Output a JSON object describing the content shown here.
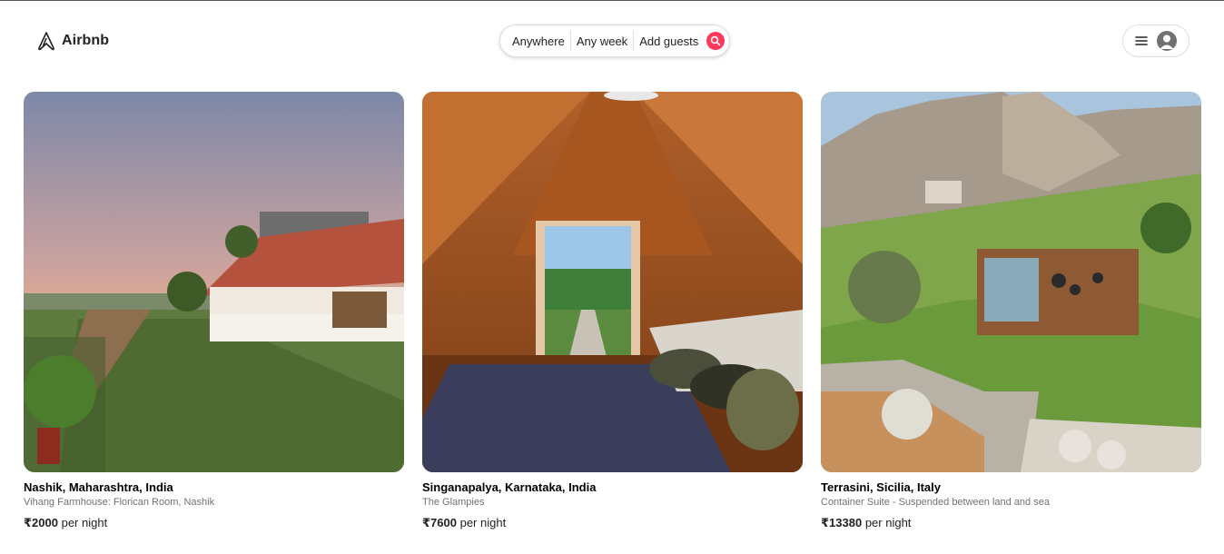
{
  "brand": {
    "name": "Airbnb",
    "accent": "#ff385c"
  },
  "search": {
    "anywhere": "Anywhere",
    "any_week": "Any week",
    "add_guests": "Add guests",
    "search_icon": "search-icon"
  },
  "user_menu": {
    "menu_icon": "hamburger-icon",
    "avatar_icon": "user-avatar-icon"
  },
  "listings": [
    {
      "location": "Nashik, Maharashtra, India",
      "title": "Vihang Farmhouse: Florican Room, Nashik",
      "price": "₹2000",
      "per_night": "per night"
    },
    {
      "location": "Singanapalya, Karnataka, India",
      "title": "The Glampies",
      "price": "₹7600",
      "per_night": "per night"
    },
    {
      "location": "Terrasini, Sicilia, Italy",
      "title": "Container Suite - Suspended between land and sea",
      "price": "₹13380",
      "per_night": "per night"
    }
  ]
}
